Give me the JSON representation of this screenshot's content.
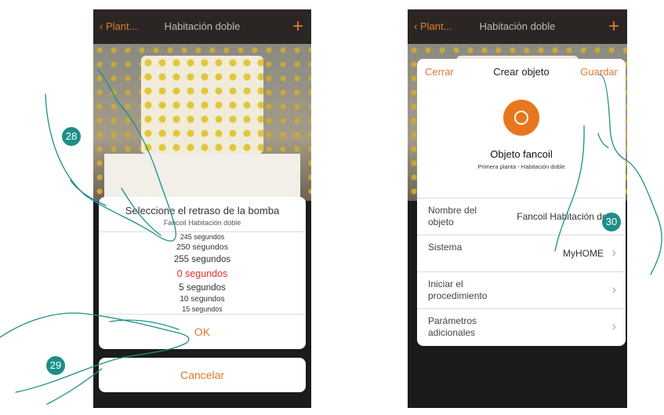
{
  "left_screen": {
    "header": {
      "back_label": "Plant...",
      "title": "Habitación doble",
      "add_label": "+"
    },
    "picker_sheet": {
      "title": "Seleccione el retraso de la bomba",
      "subtitle": "Fancoil Habitación doble",
      "options": [
        "245 segundos",
        "250 segundos",
        "255 segundos",
        "0 segundos",
        "5 segundos",
        "10 segundos",
        "15 segundos"
      ],
      "selected_index": 3,
      "ok_label": "OK",
      "cancel_label": "Cancelar"
    }
  },
  "right_screen": {
    "header": {
      "back_label": "Plant...",
      "title": "Habitación doble",
      "add_label": "+"
    },
    "dialog": {
      "close_label": "Cerrar",
      "title": "Crear objeto",
      "save_label": "Guardar",
      "object_name": "Objeto fancoil",
      "object_location": "Primera planta - Habitación doble",
      "rows": [
        {
          "label": "Nombre del objeto",
          "value": "Fancoil Habitación dobl",
          "chevron": false
        },
        {
          "label": "Sistema",
          "value": "MyHOME",
          "chevron": true
        },
        {
          "label": "Iniciar el procedimiento",
          "value": "",
          "chevron": true
        },
        {
          "label": "Parámetros adicionales",
          "value": "",
          "chevron": true
        }
      ]
    }
  },
  "step_badges": [
    "28",
    "29",
    "30"
  ],
  "colors": {
    "accent": "#e07a2f",
    "badge": "#1f8e88",
    "selected": "#e8302a"
  }
}
